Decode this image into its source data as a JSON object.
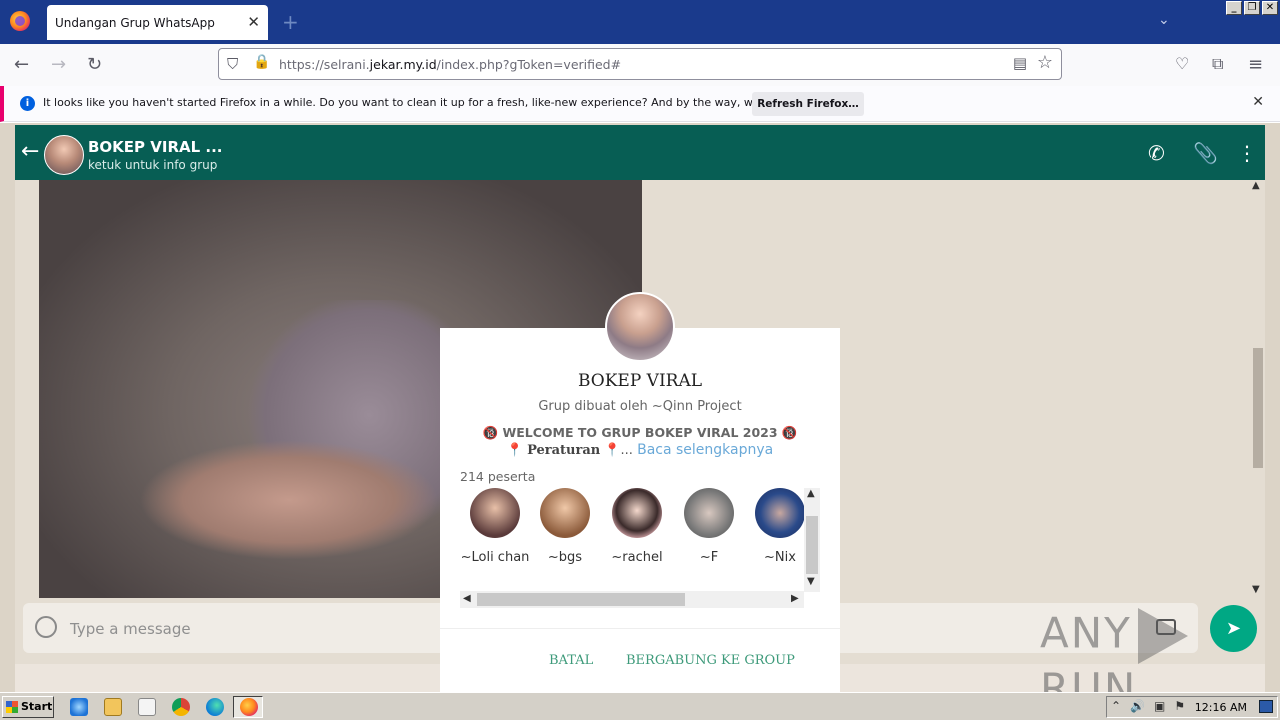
{
  "browser": {
    "tab_title": "Undangan Grup WhatsApp",
    "url_prefix": "https://selrani.",
    "url_host": "jekar.my.id",
    "url_suffix": "/index.php?gToken=verified#",
    "notice_text": "It looks like you haven't started Firefox in a while. Do you want to clean it up for a fresh, like-new experience? And by the way, welcome back!",
    "notice_button": "Refresh Firefox…"
  },
  "header": {
    "title": "BOKEP VIRAL ...",
    "subtitle": "ketuk untuk info grup"
  },
  "composer": {
    "placeholder": "Type a message"
  },
  "modal": {
    "title": "BOKEP VIRAL",
    "creator": "Grup dibuat oleh ~Qinn Project",
    "desc_line1": "🔞 WELCOME TO GRUP BOKEP VIRAL 2023 🔞",
    "desc_rules": "Peraturan",
    "desc_ellipsis": "...",
    "read_more": "Baca selengkapnya",
    "participants": "214 peserta",
    "members": [
      {
        "name": "~Loli chan",
        "color": "#5a3a3a"
      },
      {
        "name": "~bgs",
        "color": "#8b5a3a"
      },
      {
        "name": "~rachel",
        "color": "#e8b4b8"
      },
      {
        "name": "~F",
        "color": "#7a7a7a"
      },
      {
        "name": "~Nix",
        "color": "#2a4a8a"
      }
    ],
    "cancel": "BATAL",
    "join": "BERGABUNG KE GROUP"
  },
  "watermark": {
    "left": "ANY",
    "right": "RUN"
  },
  "taskbar": {
    "start": "Start",
    "clock": "12:16 AM"
  },
  "colors": {
    "wa_green": "#075e54",
    "accent": "#00a884",
    "button_text": "#3d9a7a"
  }
}
